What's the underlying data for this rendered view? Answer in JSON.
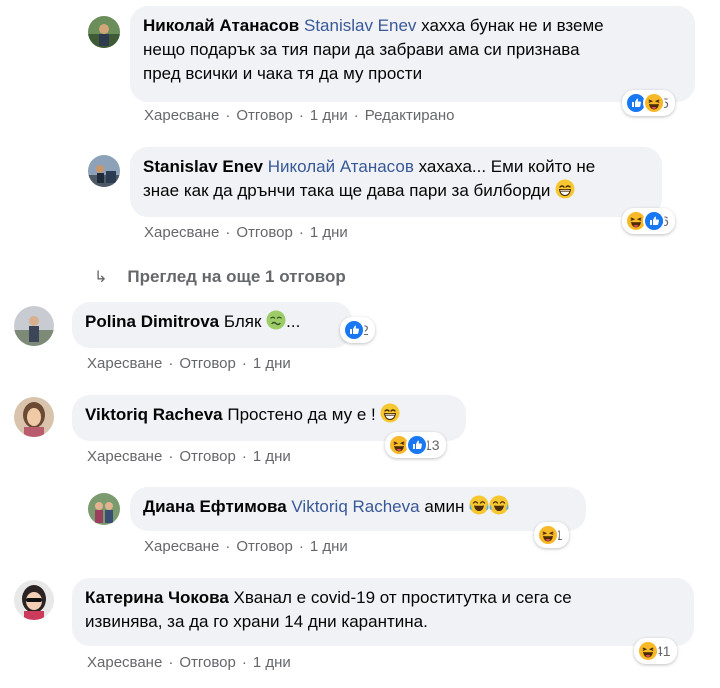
{
  "actions": {
    "like": "Харесване",
    "reply": "Отговор",
    "sep": "·",
    "edited": "Редактирано"
  },
  "comments": [
    {
      "author": "Николай Атанасов",
      "mention": "Stanislav Enev",
      "text_lines": [
        "хахха бунак не и вземе",
        "нещо подарък за тия пари да забрави ама си признава",
        "пред всички и чака тя да му прости"
      ],
      "time": "1 дни",
      "reaction_count": "5",
      "reactions": [
        "like",
        "haha"
      ]
    },
    {
      "author": "Stanislav Enev",
      "mention": "Николай Атанасов",
      "text_lines": [
        "хахаха... Еми който не",
        "знае как да дрънчи така ще дава пари за билборди"
      ],
      "time": "1 дни",
      "reaction_count": "6",
      "reactions": [
        "haha",
        "like"
      ]
    },
    {
      "author": "Polina Dimitrova",
      "text": "Бляк",
      "text_after": "...",
      "time": "1 дни",
      "reaction_count": "2",
      "reactions": [
        "like"
      ]
    },
    {
      "author": "Viktoriq Racheva",
      "text": "Простено да му е !",
      "time": "1 дни",
      "reaction_count": "13",
      "reactions": [
        "haha",
        "like"
      ]
    },
    {
      "author": "Диана Ефтимова",
      "mention": "Viktoriq Racheva",
      "text": "амин",
      "time": "1 дни",
      "reaction_count": "1",
      "reactions": [
        "haha"
      ]
    },
    {
      "author": "Катерина Чокова",
      "text_lines": [
        "Хванал е covid-19 от проститутка и сега се",
        "извинява, за да го храни 14 дни карантина."
      ],
      "time": "1 дни",
      "reaction_count": "41",
      "reactions": [
        "haha"
      ]
    }
  ],
  "more_replies": {
    "label": "Преглед на още 1 отговор"
  },
  "icons": {
    "like": "like-reaction-icon",
    "haha": "haha-reaction-icon",
    "grin": "grinning-emoji-icon",
    "sick": "nauseated-emoji-icon",
    "tears": "tears-of-joy-emoji-icon",
    "reply_arrow": "reply-arrow-icon"
  },
  "colors": {
    "bubble": "#f0f2f5",
    "mention": "#385898",
    "meta": "#65676b",
    "like_blue": "#1877f2",
    "haha_yellow": "#f7b928"
  }
}
